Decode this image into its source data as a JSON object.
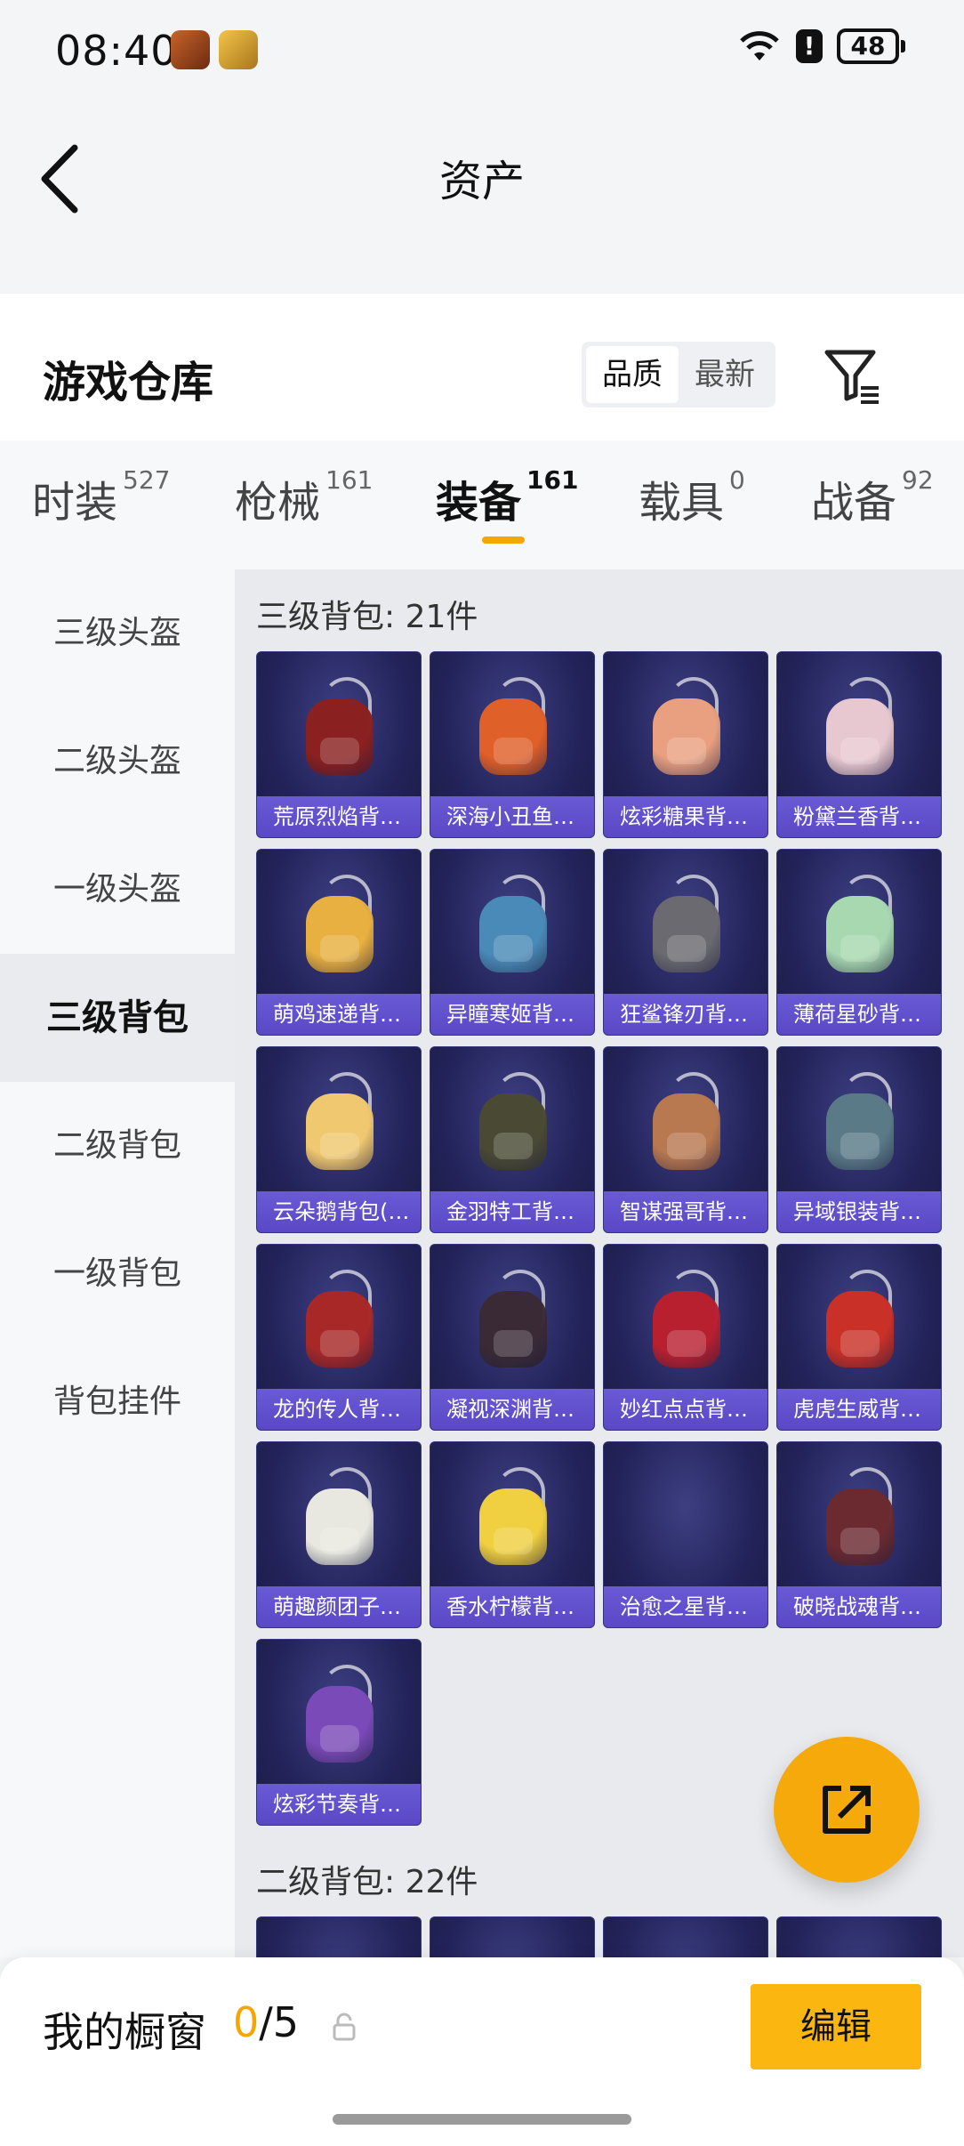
{
  "status": {
    "time": "08:40",
    "battery": "48"
  },
  "header": {
    "title": "资产"
  },
  "warehouse": {
    "title": "游戏仓库",
    "sort_options": [
      "品质",
      "最新"
    ],
    "sort_selected": "品质"
  },
  "tabs": [
    {
      "label": "时装",
      "count": "527"
    },
    {
      "label": "枪械",
      "count": "161"
    },
    {
      "label": "装备",
      "count": "161"
    },
    {
      "label": "载具",
      "count": "0"
    },
    {
      "label": "战备",
      "count": "92"
    }
  ],
  "active_tab": "装备",
  "sidebar": {
    "items": [
      "三级头盔",
      "二级头盔",
      "一级头盔",
      "三级背包",
      "二级背包",
      "一级背包",
      "背包挂件"
    ],
    "active": "三级背包"
  },
  "sections": [
    {
      "title": "三级背包: 21件",
      "items": [
        {
          "label": "荒原烈焰背…",
          "icon": "red-backpack-icon",
          "color": "#8a2020"
        },
        {
          "label": "深海小丑鱼…",
          "icon": "clownfish-backpack-icon",
          "color": "#e0602a"
        },
        {
          "label": "炫彩糖果背…",
          "icon": "candy-backpack-icon",
          "color": "#e8a080"
        },
        {
          "label": "粉黛兰香背…",
          "icon": "pink-backpack-icon",
          "color": "#e8c8d0"
        },
        {
          "label": "萌鸡速递背…",
          "icon": "chick-backpack-icon",
          "color": "#e8b040"
        },
        {
          "label": "异瞳寒姬背…",
          "icon": "bunny-backpack-icon",
          "color": "#4a8ab8"
        },
        {
          "label": "狂鲨锋刃背…",
          "icon": "shark-backpack-icon",
          "color": "#6a6a70"
        },
        {
          "label": "薄荷星砂背…",
          "icon": "mint-backpack-icon",
          "color": "#a8d8b0"
        },
        {
          "label": "云朵鹅背包(…",
          "icon": "goose-backpack-icon",
          "color": "#f0c870"
        },
        {
          "label": "金羽特工背…",
          "icon": "tactical-backpack-icon",
          "color": "#4a4a34"
        },
        {
          "label": "智谋强哥背…",
          "icon": "hamster-backpack-icon",
          "color": "#b87850"
        },
        {
          "label": "异域银装背…",
          "icon": "silver-backpack-icon",
          "color": "#5a7a88"
        },
        {
          "label": "龙的传人背…",
          "icon": "dragon-backpack-icon",
          "color": "#a82828"
        },
        {
          "label": "凝视深渊背…",
          "icon": "abyss-backpack-icon",
          "color": "#3a2a36"
        },
        {
          "label": "妙红点点背…",
          "icon": "ladybug-backpack-icon",
          "color": "#b82030"
        },
        {
          "label": "虎虎生威背…",
          "icon": "tiger-backpack-icon",
          "color": "#c83028"
        },
        {
          "label": "萌趣颜团子…",
          "icon": "mochi-backpack-icon",
          "color": "#e8e8e0"
        },
        {
          "label": "香水柠檬背…",
          "icon": "lemon-backpack-icon",
          "color": "#f0d040"
        },
        {
          "label": "治愈之星背…",
          "icon": "star-backpack-icon",
          "color": ""
        },
        {
          "label": "破晓战魂背…",
          "icon": "warrior-backpack-icon",
          "color": "#6a2a30"
        },
        {
          "label": "炫彩节奏背…",
          "icon": "rhythm-backpack-icon",
          "color": "#7a4ab8"
        }
      ]
    },
    {
      "title": "二级背包: 22件",
      "items": [
        {
          "label": "",
          "icon": "backpack-icon",
          "color": ""
        },
        {
          "label": "",
          "icon": "backpack-icon",
          "color": ""
        },
        {
          "label": "",
          "icon": "backpack-icon",
          "color": ""
        },
        {
          "label": "",
          "icon": "backpack-icon",
          "color": ""
        }
      ]
    }
  ],
  "showcase": {
    "label": "我的橱窗",
    "current": "0",
    "total": "/5"
  },
  "edit_button": "编辑",
  "colors": {
    "accent": "#f5a700",
    "card_label": "#5a48c6",
    "card_bg": "#23235a"
  }
}
